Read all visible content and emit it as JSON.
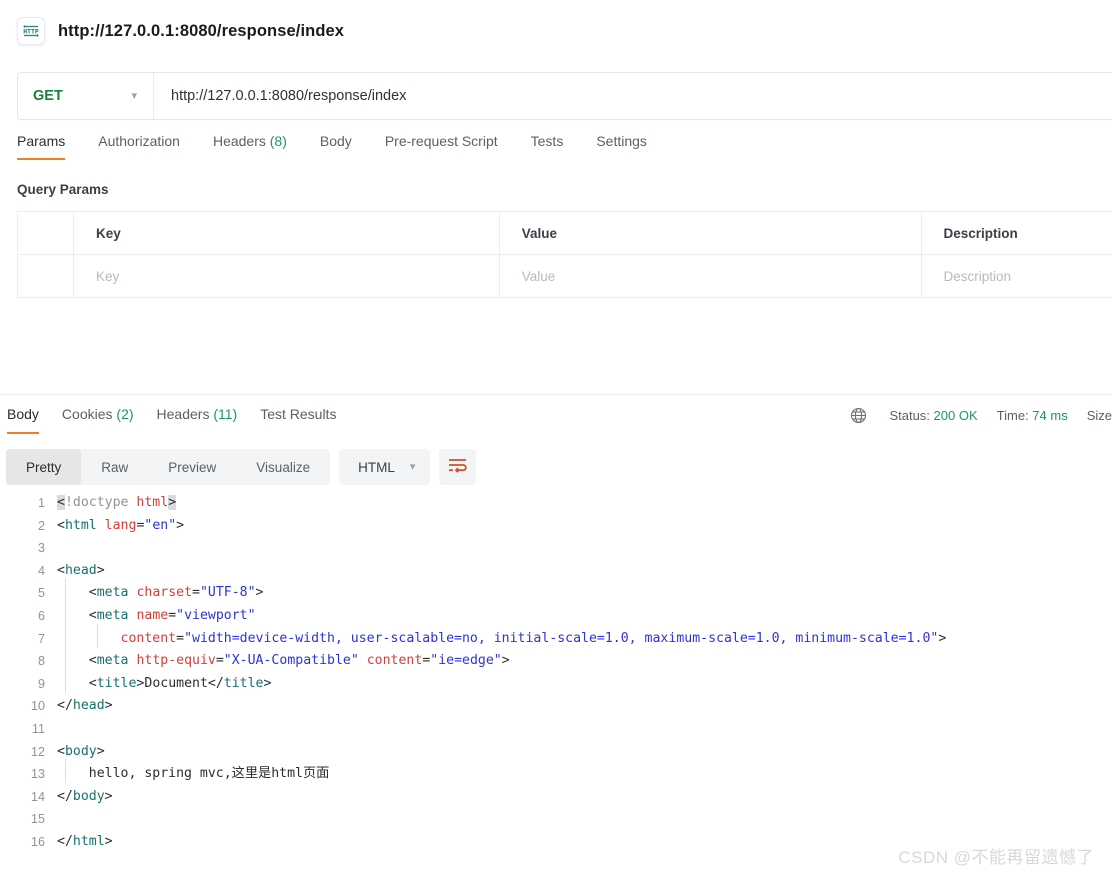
{
  "header": {
    "icon": "http-icon",
    "request_title": "http://127.0.0.1:8080/response/index"
  },
  "url_bar": {
    "method": "GET",
    "method_chevron": "chevron-down-icon",
    "url": "http://127.0.0.1:8080/response/index"
  },
  "request_tabs": [
    {
      "label": "Params",
      "count": "",
      "active": true
    },
    {
      "label": "Authorization",
      "count": "",
      "active": false
    },
    {
      "label": "Headers",
      "count": "(8)",
      "active": false
    },
    {
      "label": "Body",
      "count": "",
      "active": false
    },
    {
      "label": "Pre-request Script",
      "count": "",
      "active": false
    },
    {
      "label": "Tests",
      "count": "",
      "active": false
    },
    {
      "label": "Settings",
      "count": "",
      "active": false
    }
  ],
  "query_params": {
    "section_label": "Query Params",
    "columns": [
      "Key",
      "Value",
      "Description"
    ],
    "rows": [
      {
        "key": "Key",
        "value": "Value",
        "description": "Description"
      }
    ]
  },
  "response": {
    "tabs": [
      {
        "label": "Body",
        "count": "",
        "active": true
      },
      {
        "label": "Cookies",
        "count": "(2)",
        "active": false
      },
      {
        "label": "Headers",
        "count": "(11)",
        "active": false
      },
      {
        "label": "Test Results",
        "count": "",
        "active": false
      }
    ],
    "meta": {
      "globe_icon": "globe-icon",
      "status_label": "Status:",
      "status_value": "200 OK",
      "time_label": "Time:",
      "time_value": "74 ms",
      "size_label": "Size"
    },
    "format_tabs": [
      {
        "label": "Pretty",
        "active": true
      },
      {
        "label": "Raw",
        "active": false
      },
      {
        "label": "Preview",
        "active": false
      },
      {
        "label": "Visualize",
        "active": false
      }
    ],
    "language": "HTML",
    "language_chevron": "chevron-down-icon",
    "wrap_button": "word-wrap-icon"
  },
  "code_lines": [
    {
      "n": "1",
      "guide": 0
    },
    {
      "n": "2",
      "guide": 0
    },
    {
      "n": "3",
      "guide": 0
    },
    {
      "n": "4",
      "guide": 0
    },
    {
      "n": "5",
      "guide": 1
    },
    {
      "n": "6",
      "guide": 1
    },
    {
      "n": "7",
      "guide": 2
    },
    {
      "n": "8",
      "guide": 1
    },
    {
      "n": "9",
      "guide": 1
    },
    {
      "n": "10",
      "guide": 0
    },
    {
      "n": "11",
      "guide": 0
    },
    {
      "n": "12",
      "guide": 0
    },
    {
      "n": "13",
      "guide": 1
    },
    {
      "n": "14",
      "guide": 0
    },
    {
      "n": "15",
      "guide": 0
    },
    {
      "n": "16",
      "guide": 0
    }
  ],
  "code_text": {
    "l1_lt": "<",
    "l1_doctype": "!doctype ",
    "l1_name": "html",
    "l1_gt": ">",
    "l2_a": "<",
    "l2_tag": "html",
    "l2_sp": " ",
    "l2_attr": "lang",
    "l2_eq": "=",
    "l2_val": "\"en\"",
    "l2_gt": ">",
    "l4_a": "<",
    "l4_tag": "head",
    "l4_gt": ">",
    "l5_ind": "    ",
    "l5_a": "<",
    "l5_tag": "meta",
    "l5_sp": " ",
    "l5_attr": "charset",
    "l5_eq": "=",
    "l5_val": "\"UTF-8\"",
    "l5_gt": ">",
    "l6_ind": "    ",
    "l6_a": "<",
    "l6_tag": "meta",
    "l6_sp": " ",
    "l6_attr": "name",
    "l6_eq": "=",
    "l6_val": "\"viewport\"",
    "l7_ind": "        ",
    "l7_attr": "content",
    "l7_eq": "=",
    "l7_val": "\"width=device-width, user-scalable=no, initial-scale=1.0, maximum-scale=1.0, minimum-scale=1.0\"",
    "l7_gt": ">",
    "l8_ind": "    ",
    "l8_a": "<",
    "l8_tag": "meta",
    "l8_sp": " ",
    "l8_attr": "http-equiv",
    "l8_eq": "=",
    "l8_val": "\"X-UA-Compatible\"",
    "l8_sp2": " ",
    "l8_attr2": "content",
    "l8_eq2": "=",
    "l8_val2": "\"ie=edge\"",
    "l8_gt": ">",
    "l9_ind": "    ",
    "l9_a": "<",
    "l9_tag": "title",
    "l9_gt": ">",
    "l9_text": "Document",
    "l9_close": "</",
    "l9_ctag": "title",
    "l9_cgt": ">",
    "l10_close": "</",
    "l10_tag": "head",
    "l10_gt": ">",
    "l12_a": "<",
    "l12_tag": "body",
    "l12_gt": ">",
    "l13_ind": "    ",
    "l13_text": "hello, spring mvc,这里是html页面",
    "l14_close": "</",
    "l14_tag": "body",
    "l14_gt": ">",
    "l16_close": "</",
    "l16_tag": "html",
    "l16_gt": ">"
  },
  "watermark": "CSDN @不能再留遗憾了",
  "colors": {
    "accent_orange": "#ef7c29",
    "method_green": "#1a7f37",
    "status_green": "#1a9a5a",
    "tag_teal": "#17706e",
    "attr_red": "#d1403a",
    "string_blue": "#2d33d6",
    "border": "#ebedef"
  }
}
